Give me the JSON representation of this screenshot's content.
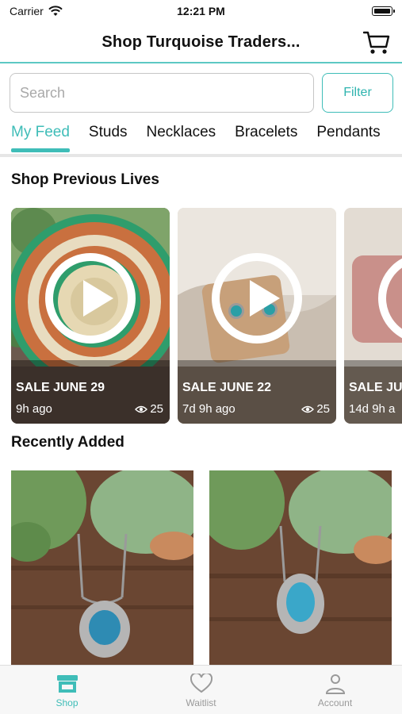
{
  "status_bar": {
    "carrier": "Carrier",
    "time": "12:21 PM"
  },
  "header": {
    "title": "Shop Turquoise Traders..."
  },
  "search": {
    "placeholder": "Search",
    "filter_label": "Filter"
  },
  "category_tabs": [
    {
      "label": "My Feed",
      "active": true
    },
    {
      "label": "Studs"
    },
    {
      "label": "Necklaces"
    },
    {
      "label": "Bracelets"
    },
    {
      "label": "Pendants"
    }
  ],
  "sections": {
    "previous_lives": "Shop Previous Lives",
    "recently_added": "Recently Added"
  },
  "lives": [
    {
      "title": "SALE JUNE 29",
      "ago": "9h ago",
      "views": "25"
    },
    {
      "title": "SALE JUNE 22",
      "ago": "7d 9h ago",
      "views": "25"
    },
    {
      "title": "SALE JU",
      "ago": "14d 9h a"
    }
  ],
  "bottom_tabs": [
    {
      "label": "Shop",
      "icon": "store-icon",
      "active": true
    },
    {
      "label": "Waitlist",
      "icon": "heart-icon"
    },
    {
      "label": "Account",
      "icon": "person-icon"
    }
  ],
  "colors": {
    "accent": "#3fbdb8",
    "header_rule": "#5cc8c4"
  }
}
